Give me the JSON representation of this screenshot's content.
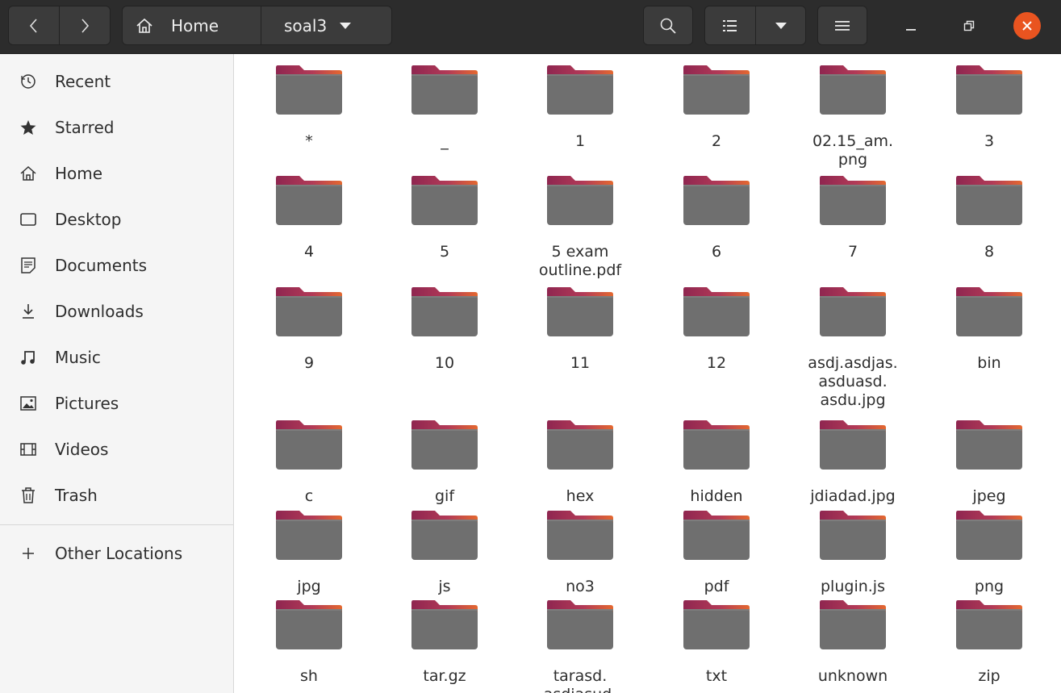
{
  "header": {
    "breadcrumb_home": "Home",
    "breadcrumb_current": "soal3"
  },
  "sidebar": {
    "items": [
      {
        "label": "Recent",
        "icon": "clock-icon"
      },
      {
        "label": "Starred",
        "icon": "star-icon"
      },
      {
        "label": "Home",
        "icon": "home-icon"
      },
      {
        "label": "Desktop",
        "icon": "desktop-icon"
      },
      {
        "label": "Documents",
        "icon": "document-icon"
      },
      {
        "label": "Downloads",
        "icon": "download-icon"
      },
      {
        "label": "Music",
        "icon": "music-icon"
      },
      {
        "label": "Pictures",
        "icon": "picture-icon"
      },
      {
        "label": "Videos",
        "icon": "video-icon"
      },
      {
        "label": "Trash",
        "icon": "trash-icon"
      }
    ],
    "other_locations": "Other Locations"
  },
  "files": [
    "*",
    "_",
    "1",
    "2",
    "02.15_am.\npng",
    "3",
    "4",
    "5",
    "5 exam\noutline.pdf",
    "6",
    "7",
    "8",
    "9",
    "10",
    "11",
    "12",
    "asdj.asdjas.\nasduasd.\nasdu.jpg",
    "bin",
    "c",
    "gif",
    "hex",
    "hidden",
    "jdiadad.jpg",
    "jpeg",
    "jpg",
    "js",
    "no3",
    "pdf",
    "plugin.js",
    "png",
    "sh",
    "tar.gz",
    "tarasd.\nasdiasud.",
    "txt",
    "unknown",
    "zip"
  ],
  "colors": {
    "header_bg": "#2c2c2c",
    "accent": "#e95420",
    "folder_body": "#6b6b6b",
    "folder_tab": "#a6334f"
  }
}
